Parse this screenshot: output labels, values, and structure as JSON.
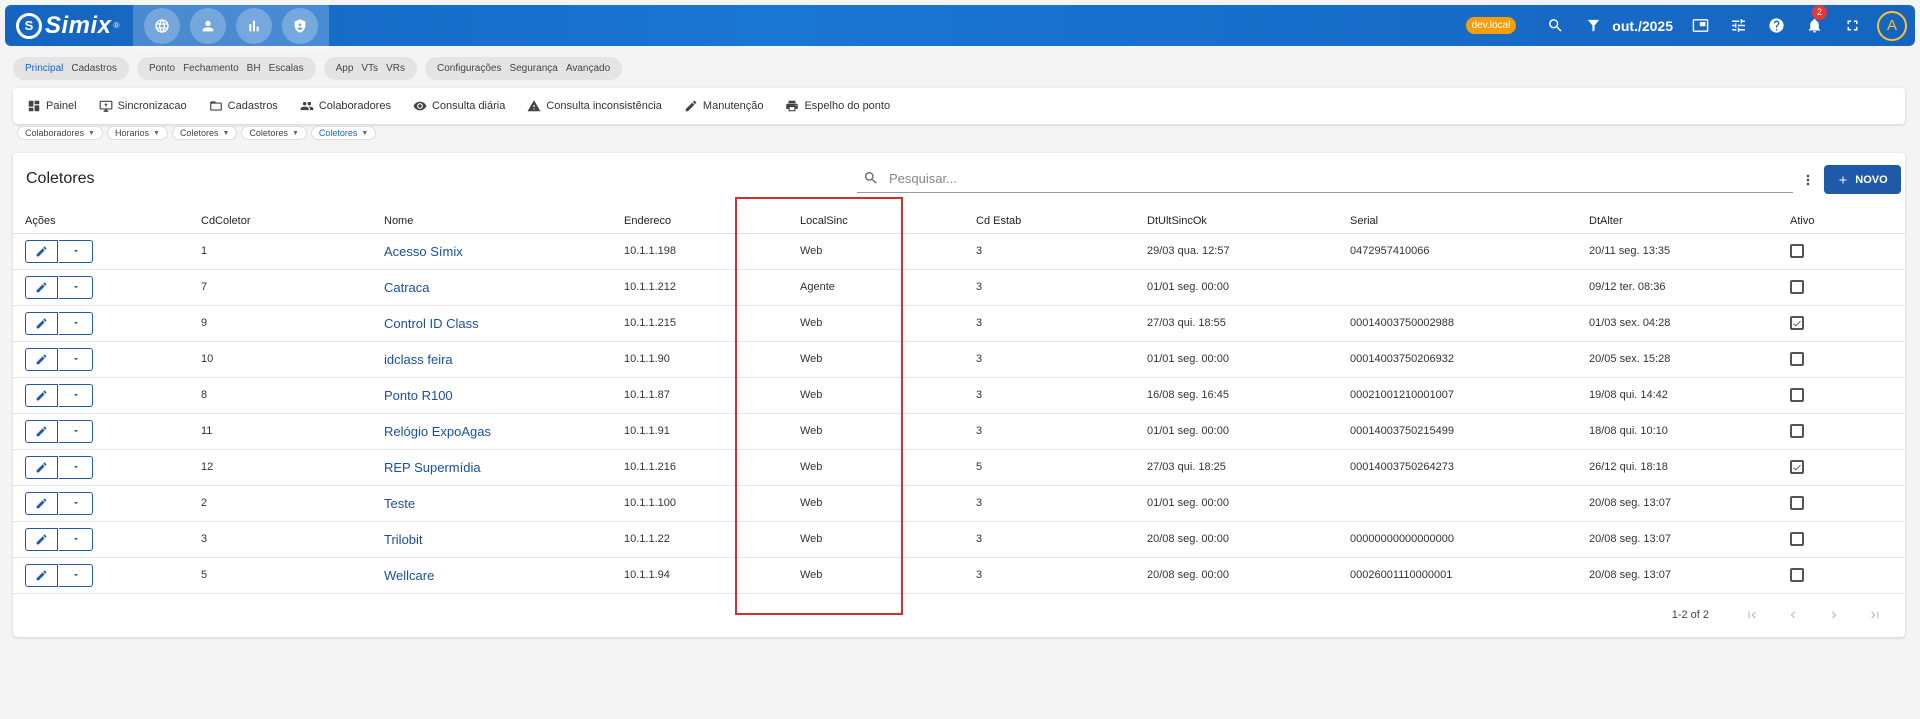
{
  "app": {
    "logo_mark": "S",
    "logo_text": "Simix",
    "logo_reg": "®"
  },
  "topbar": {
    "env_badge": "dev.local",
    "period": "out./2025",
    "notifications": "2",
    "avatar": "A",
    "quick_icons": [
      "globe-icon",
      "person-icon",
      "bar-chart-icon",
      "shield-icon"
    ]
  },
  "chips": [
    {
      "items": [
        {
          "label": "Principal",
          "active": true
        },
        {
          "label": "Cadastros",
          "active": false
        }
      ]
    },
    {
      "items": [
        {
          "label": "Ponto"
        },
        {
          "label": "Fechamento"
        },
        {
          "label": "BH"
        },
        {
          "label": "Escalas"
        }
      ]
    },
    {
      "items": [
        {
          "label": "App"
        },
        {
          "label": "VTs"
        },
        {
          "label": "VRs"
        }
      ]
    },
    {
      "items": [
        {
          "label": "Configurações"
        },
        {
          "label": "Segurança"
        },
        {
          "label": "Avançado"
        }
      ]
    }
  ],
  "nav": [
    {
      "label": "Painel",
      "icon": "dashboard-icon"
    },
    {
      "label": "Sincronizacao",
      "icon": "sync-icon"
    },
    {
      "label": "Cadastros",
      "icon": "folder-icon"
    },
    {
      "label": "Colaboradores",
      "icon": "people-icon"
    },
    {
      "label": "Consulta diária",
      "icon": "eye-icon"
    },
    {
      "label": "Consulta inconsistência",
      "icon": "warning-icon"
    },
    {
      "label": "Manutenção",
      "icon": "pencil-icon"
    },
    {
      "label": "Espelho do ponto",
      "icon": "printer-icon"
    }
  ],
  "breadcrumbs": [
    "Colaboradores",
    "Horarios",
    "Coletores",
    "Coletores",
    "Coletores"
  ],
  "card": {
    "title": "Coletores",
    "search_placeholder": "Pesquisar...",
    "new_label": "NOVO"
  },
  "table": {
    "columns": [
      "Ações",
      "CdColetor",
      "Nome",
      "Endereco",
      "LocalSinc",
      "Cd Estab",
      "DtUltSincOk",
      "Serial",
      "DtAlter",
      "Ativo"
    ],
    "rows": [
      {
        "cd": "1",
        "nome": "Acesso Símix",
        "endereco": "10.1.1.198",
        "local": "Web",
        "estab": "3",
        "ult": "29/03 qua. 12:57",
        "serial": "0472957410066",
        "alter": "20/11 seg. 13:35",
        "ativo": false
      },
      {
        "cd": "7",
        "nome": "Catraca",
        "endereco": "10.1.1.212",
        "local": "Agente",
        "estab": "3",
        "ult": "01/01 seg. 00:00",
        "serial": "",
        "alter": "09/12 ter. 08:36",
        "ativo": false
      },
      {
        "cd": "9",
        "nome": "Control ID Class",
        "endereco": "10.1.1.215",
        "local": "Web",
        "estab": "3",
        "ult": "27/03 qui. 18:55",
        "serial": "00014003750002988",
        "alter": "01/03 sex. 04:28",
        "ativo": true
      },
      {
        "cd": "10",
        "nome": "idclass feira",
        "endereco": "10.1.1.90",
        "local": "Web",
        "estab": "3",
        "ult": "01/01 seg. 00:00",
        "serial": "00014003750206932",
        "alter": "20/05 sex. 15:28",
        "ativo": false
      },
      {
        "cd": "8",
        "nome": "Ponto R100",
        "endereco": "10.1.1.87",
        "local": "Web",
        "estab": "3",
        "ult": "16/08 seg. 16:45",
        "serial": "00021001210001007",
        "alter": "19/08 qui. 14:42",
        "ativo": false
      },
      {
        "cd": "11",
        "nome": "Relógio ExpoAgas",
        "endereco": "10.1.1.91",
        "local": "Web",
        "estab": "3",
        "ult": "01/01 seg. 00:00",
        "serial": "00014003750215499",
        "alter": "18/08 qui. 10:10",
        "ativo": false
      },
      {
        "cd": "12",
        "nome": "REP Supermídia",
        "endereco": "10.1.1.216",
        "local": "Web",
        "estab": "5",
        "ult": "27/03 qui. 18:25",
        "serial": "00014003750264273",
        "alter": "26/12 qui. 18:18",
        "ativo": true
      },
      {
        "cd": "2",
        "nome": "Teste",
        "endereco": "10.1.1.100",
        "local": "Web",
        "estab": "3",
        "ult": "01/01 seg. 00:00",
        "serial": "",
        "alter": "20/08 seg. 13:07",
        "ativo": false
      },
      {
        "cd": "3",
        "nome": "Trilobit",
        "endereco": "10.1.1.22",
        "local": "Web",
        "estab": "3",
        "ult": "20/08 seg. 00:00",
        "serial": "00000000000000000",
        "alter": "20/08 seg. 13:07",
        "ativo": false
      },
      {
        "cd": "5",
        "nome": "Wellcare",
        "endereco": "10.1.1.94",
        "local": "Web",
        "estab": "3",
        "ult": "20/08 seg. 00:00",
        "serial": "00026001110000001",
        "alter": "20/08 seg. 13:07",
        "ativo": false
      }
    ]
  },
  "pagination": {
    "info": "1-2 of 2"
  },
  "colors": {
    "primary": "#1565c0",
    "button": "#1e5aa8",
    "badge": "#f59e0b",
    "highlight": "#d32f2f"
  }
}
